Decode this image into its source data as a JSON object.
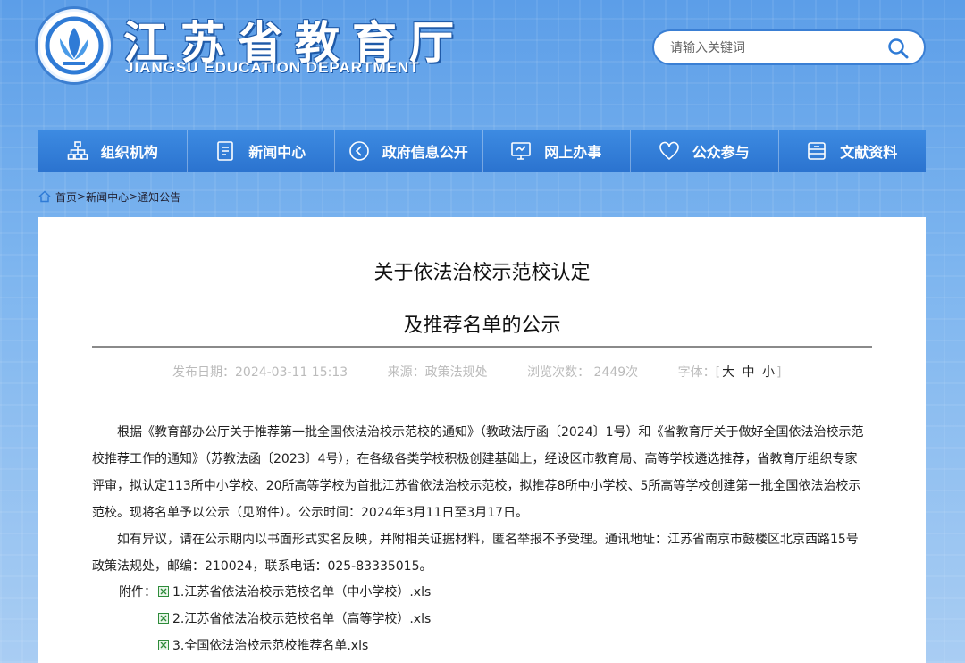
{
  "header": {
    "title": "江苏省教育厅",
    "subtitle": "JIANGSU EDUCATION DEPARTMENT",
    "search_placeholder": "请输入关键词"
  },
  "nav": [
    {
      "label": "组织机构",
      "icon": "org-chart-icon"
    },
    {
      "label": "新闻中心",
      "icon": "document-icon"
    },
    {
      "label": "政府信息公开",
      "icon": "megaphone-icon"
    },
    {
      "label": "网上办事",
      "icon": "monitor-icon"
    },
    {
      "label": "公众参与",
      "icon": "heart-icon"
    },
    {
      "label": "文献资料",
      "icon": "archive-icon"
    }
  ],
  "breadcrumb": {
    "home": "首页",
    "sep": ">",
    "news": "新闻中心",
    "current": "通知公告"
  },
  "article": {
    "title_line1": "关于依法治校示范校认定",
    "title_line2": "及推荐名单的公示",
    "date": "发布日期：2024-03-11 15:13",
    "source": "来源：政策法规处",
    "views": "浏览次数： 2449次",
    "font_label": "字体：[",
    "font_large": "大",
    "font_medium": "中",
    "font_small": "小",
    "font_close": "]",
    "para1": "根据《教育部办公厅关于推荐第一批全国依法治校示范校的通知》（教政法厅函〔2024〕1号）和《省教育厅关于做好全国依法治校示范校推荐工作的通知》（苏教法函〔2023〕4号），在各级各类学校积极创建基础上，经设区市教育局、高等学校遴选推荐，省教育厅组织专家评审，拟认定113所中小学校、20所高等学校为首批江苏省依法治校示范校，拟推荐8所中小学校、5所高等学校创建第一批全国依法治校示范校。现将名单予以公示（见附件）。公示时间：2024年3月11日至3月17日。",
    "para2": "如有异议，请在公示期内以书面形式实名反映，并附相关证据材料，匿名举报不予受理。通讯地址：江苏省南京市鼓楼区北京西路15号政策法规处，邮编：210024，联系电话：025-83335015。",
    "attachments_label": "附件：",
    "attachments": [
      "1.江苏省依法治校示范校名单（中小学校）.xls",
      "2.江苏省依法治校示范校名单（高等学校）.xls",
      "3.全国依法治校示范校推荐名单.xls"
    ]
  },
  "colors": {
    "nav_bg": "#2f7bd6",
    "page_bg": "#6aa9ec",
    "attachment_icon": "#2e8b3a"
  }
}
